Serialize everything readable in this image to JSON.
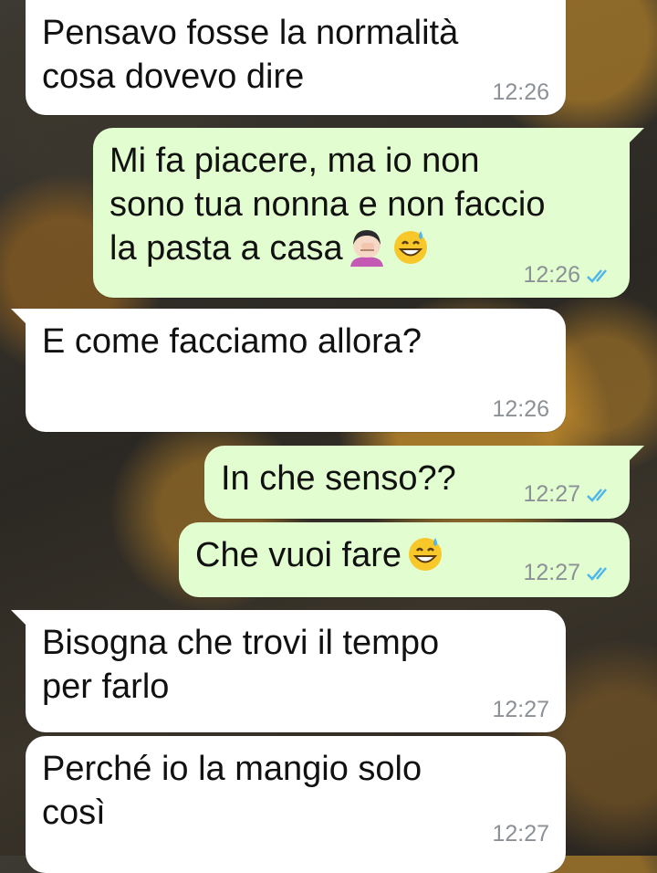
{
  "messages": [
    {
      "direction": "in",
      "text": "Pensavo fosse la normalità\ncosa dovevo dire",
      "time": "12:26"
    },
    {
      "direction": "out",
      "text": "Mi fa piacere, ma io non\nsono tua nonna e non faccio\nla pasta a casa",
      "emojis": [
        "woman-facepalming-emoji",
        "grinning-sweat-emoji"
      ],
      "time": "12:26",
      "status": "read"
    },
    {
      "direction": "in",
      "text": "E come facciamo allora?",
      "time": "12:26"
    },
    {
      "direction": "out",
      "text": "In che senso??",
      "time": "12:27",
      "status": "read"
    },
    {
      "direction": "out",
      "text": "Che vuoi fare",
      "emojis": [
        "grinning-sweat-emoji"
      ],
      "time": "12:27",
      "status": "read"
    },
    {
      "direction": "in",
      "text": "Bisogna che trovi il tempo\nper farlo",
      "time": "12:27"
    },
    {
      "direction": "in",
      "text": "Perché io la mangio solo\ncosì",
      "time": "12:27"
    }
  ],
  "colors": {
    "incoming_bubble": "#ffffff",
    "outgoing_bubble": "#e2fdcf",
    "read_ticks": "#4fb6ec",
    "timestamp": "#8b9196"
  }
}
